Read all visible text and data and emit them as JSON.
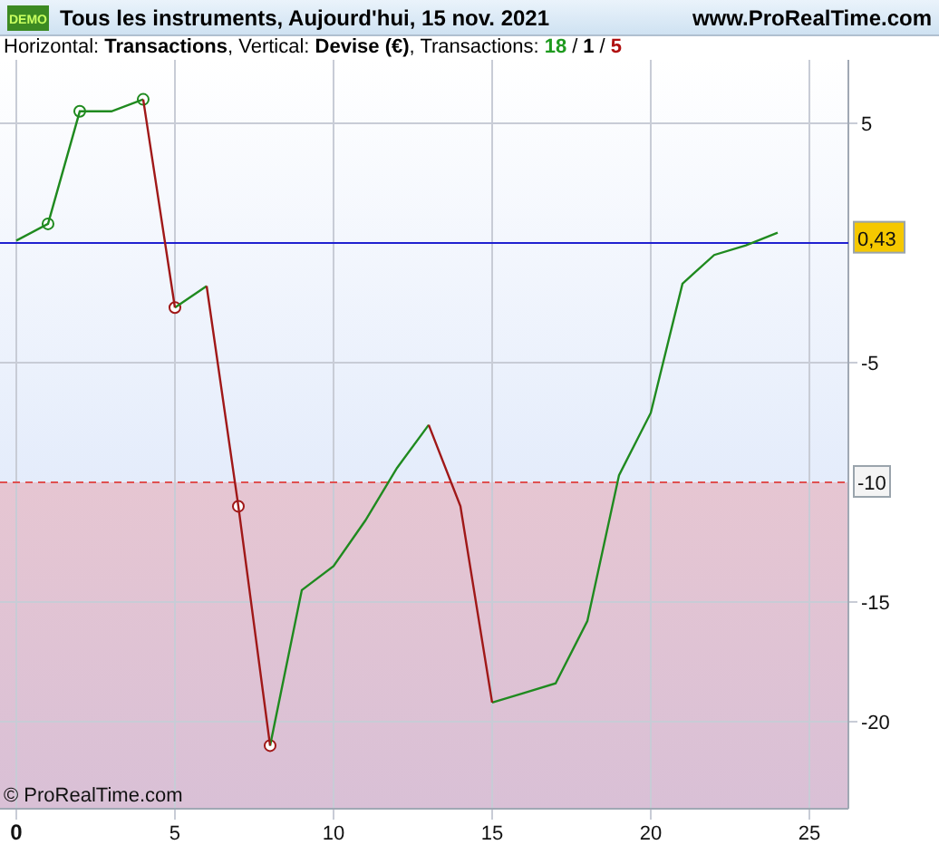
{
  "window": {
    "badge": "DEMO",
    "title": "Tous les instruments, Aujourd'hui, 15 nov. 2021",
    "site": "www.ProRealTime.com"
  },
  "info": {
    "text": "Horizontal: **Transactions**, Vertical: **Devise (€)**, Transactions:",
    "separator": "/",
    "counts": [
      {
        "value": "18",
        "color": "#1f9a1f"
      },
      {
        "value": "1",
        "color": "#000000"
      },
      {
        "value": "5",
        "color": "#b01010"
      }
    ]
  },
  "chart": {
    "copyright": "© ProRealTime.com",
    "last_value_label": "0,43",
    "chart_data": {
      "type": "line",
      "x": [
        0,
        1,
        2,
        3,
        4,
        4,
        5,
        5,
        6,
        6,
        7,
        8,
        8,
        9,
        10,
        11,
        12,
        13,
        13,
        14,
        15,
        15,
        16,
        17,
        18,
        19,
        20,
        21,
        22,
        23,
        24
      ],
      "series": [
        {
          "color": "#1f8a1f",
          "values": [
            0.1,
            0.8,
            5.5,
            5.5,
            6,
            null,
            null,
            -2.7,
            -1.8,
            null,
            null,
            null,
            -21,
            -14.5,
            -13.5,
            -11.6,
            -9.4,
            -7.6,
            null,
            null,
            null,
            -19.2,
            -18.8,
            -18.4,
            -15.8,
            -9.7,
            -7.1,
            -1.7,
            -0.5,
            -0.1,
            0.43
          ]
        },
        {
          "color": "#a01818",
          "values": [
            null,
            null,
            null,
            null,
            null,
            6,
            -2.7,
            null,
            null,
            -1.8,
            -11,
            -21,
            null,
            null,
            null,
            null,
            null,
            null,
            -7.6,
            -11,
            -19.2,
            null,
            null,
            null,
            null,
            null,
            null,
            null,
            null,
            null,
            null
          ]
        },
        {
          "type": "scatter",
          "color": "#1f8a1f",
          "values": [
            null,
            0.8,
            5.5,
            null,
            6,
            null,
            null,
            null,
            null,
            null,
            null,
            null,
            null,
            null,
            null,
            null,
            null,
            null,
            null,
            null,
            null,
            null,
            null,
            null,
            null,
            null,
            null,
            null,
            null,
            null,
            null
          ]
        },
        {
          "type": "scatter",
          "color": "#a01818",
          "values": [
            null,
            null,
            null,
            null,
            null,
            null,
            -2.7,
            null,
            null,
            null,
            -11,
            -21,
            null,
            null,
            null,
            null,
            null,
            null,
            null,
            null,
            null,
            null,
            null,
            null,
            null,
            null,
            null,
            null,
            null,
            null,
            null
          ]
        }
      ],
      "xticks": [
        0,
        5,
        10,
        15,
        20,
        25
      ],
      "yticks": [
        5,
        -5,
        -15,
        -20
      ],
      "xlim": [
        -0.514,
        26.229
      ],
      "ylim": [
        -23.636,
        7.652
      ],
      "grid": true,
      "ref_lines": [
        {
          "axis": "y",
          "value": 0,
          "color": "#2020d0"
        },
        {
          "axis": "y",
          "value": -10,
          "label": "-10",
          "color": "#e05050"
        }
      ]
    }
  }
}
